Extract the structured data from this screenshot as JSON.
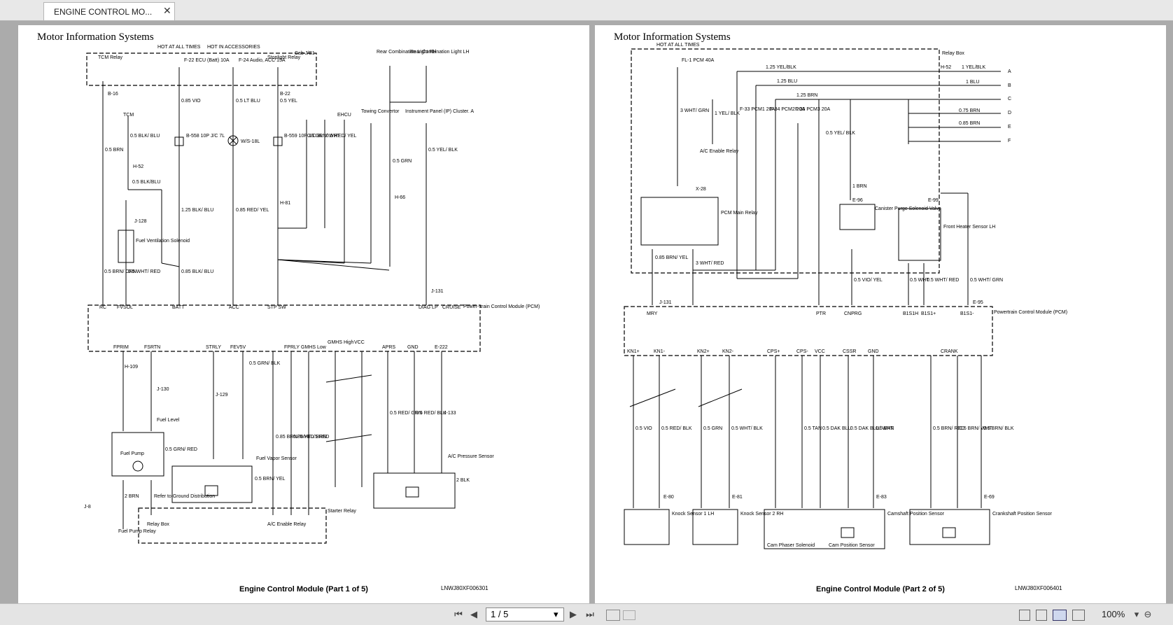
{
  "tab": {
    "title": "ENGINE CONTROL MO...",
    "close_glyph": "✕"
  },
  "pages": [
    {
      "header": "Motor Information Systems",
      "footer": "Engine Control Module (Part 1 of 5)",
      "code": "LNWJ80XF006301",
      "labels": [
        "HOT AT ALL TIMES",
        "HOT IN ACCESSORIES",
        "TCM Relay",
        "F-22 ECU (Batt) 10A",
        "F-24 Audio, ACC 15A",
        "Stoplight Relay",
        "Cab J/B1",
        "Rear Combination Light RH",
        "Rear Combination Light LH",
        "0.85 VIO",
        "0.5 LT BLU",
        "0.5 YEL",
        "B-16",
        "B-22",
        "B-558 10P J/C 7L",
        "W/S-18L",
        "B-559 10P J/C 8L",
        "TCM",
        "0.5 BLK/ BLU",
        "H-52",
        "0.5 BRN",
        "0.5 BLK/BLU",
        "0.5 GRN/ WHT",
        "0.5 RED/ YEL",
        "EHCU",
        "Towing Convertor",
        "Instrument Panel (IP) Cluster. A",
        "0.5 YEL/ BLK",
        "0.5 GRN",
        "H-66",
        "H-81",
        "J-128",
        "Fuel Ventilation Solenoid",
        "1.25 BLK/ BLU",
        "0.85 RED/ YEL",
        "0.5 BRN/ ORN",
        "0.5 WHT/ RED",
        "0.85 BLK/ BLU",
        "J-131",
        "RC",
        "FVSOL",
        "BATT",
        "ACC",
        "STP SW",
        "DIAG LP",
        "CRUISE",
        "Power- train Control Module (PCM)",
        "FPRIM",
        "FSRTN",
        "STRLY",
        "FEV5V",
        "ACPR",
        "FPRLY",
        "GMHS Low",
        "GMHS High",
        "VCC",
        "APRS",
        "GND",
        "E-222",
        "0.5 GRN/ BLK",
        "H-109",
        "J-130",
        "Fuel Level",
        "Fuel Pump",
        "0.5 GRN/ RED",
        "J-129",
        "Fuel Vapor Sensor",
        "0.5 BRN/ YEL",
        "0.85 BRN/ WHT",
        "0.85 YEL/ BRN",
        "0.5 RED",
        "0.5 RED/ GRN",
        "0.5 RED/ BLK",
        "J-133",
        "A/C Pressure Sensor",
        "2 BLK",
        "2 BRN",
        "Refer to Ground Distribution",
        "J-8",
        "Fuel Pump Relay",
        "Relay Box",
        "Starter Relay",
        "A/C Enable Relay"
      ]
    },
    {
      "header": "Motor Information Systems",
      "footer": "Engine Control Module (Part 2 of 5)",
      "code": "LNWJ80XF006401",
      "labels": [
        "HOT AT ALL TIMES",
        "Relay Box",
        "FL-1 PCM 40A",
        "1.25 YEL/BLK",
        "1.25 BLU",
        "1.25 BRN",
        "H-52",
        "1 YEL/BLK",
        "1 BLU",
        "0.75 BRN",
        "0.85 BRN",
        "A",
        "B",
        "C",
        "D",
        "E",
        "F",
        "F-33 PCM1 20A",
        "F-34 PCM2 20A",
        "F-35 PCM3 20A",
        "3 WHT/ GRN",
        "1 YEL/ BLK",
        "A/C Enable Relay",
        "0.5 YEL/ BLK",
        "1 BRN",
        "E-96",
        "Canister Purge Solenoid Valve",
        "E-99",
        "Front Heater Sensor LH",
        "X-28",
        "PCM Main Relay",
        "3 WHT/ RED",
        "0.85 BRN/ YEL",
        "0.5 VIO/ YEL",
        "0.5 WHT",
        "0.5 WHT/ RED",
        "0.5 WHT/ GRN",
        "J-131",
        "E-95",
        "MRY",
        "PTR",
        "CNPRG",
        "B1S1H",
        "B1S1+",
        "B1S1-",
        "Powertrain Control Module (PCM)",
        "KN1+",
        "KN1-",
        "KN2+",
        "KN2-",
        "CPS+",
        "CPS-",
        "VCC",
        "CSSR",
        "GND",
        "CRANK",
        "0.5 VIO",
        "0.5 RED/ BLK",
        "0.5 GRN",
        "0.5 WHT/ BLK",
        "0.5 TAN",
        "0.5 DAK BLU",
        "0.5 DAK BLU/ WHT",
        "0.5 BRN",
        "0.5 BRN/ RED",
        "0.5 BRN/ WHT",
        "0.5 BRN/ BLK",
        "E-80",
        "E-81",
        "E-83",
        "E-69",
        "Knock Sensor 1 LH",
        "Knock Sensor 2 RH",
        "Cam Phaser Solenoid",
        "Cam Position Sensor",
        "Camshaft Position Sensor",
        "Crankshaft Position Sensor"
      ]
    }
  ],
  "toolbar": {
    "first_glyph": "⏮",
    "prev_glyph": "◀",
    "page_display": "1 / 5",
    "dropdown_glyph": "▾",
    "next_glyph": "▶",
    "last_glyph": "⏭",
    "zoom": "100%",
    "zoom_out_glyph": "⊖",
    "more_glyph": "▾"
  }
}
